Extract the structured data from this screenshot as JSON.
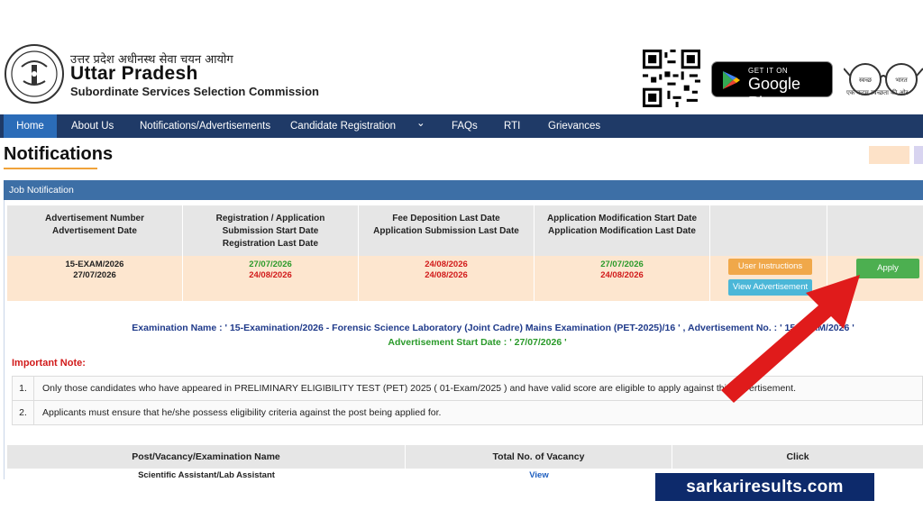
{
  "header": {
    "hindi_title": "उत्तर प्रदेश अधीनस्थ सेवा चयन आयोग",
    "title": "Uttar Pradesh",
    "subtitle": "Subordinate Services Selection Commission",
    "gplay_small": "GET IT ON",
    "gplay_big": "Google Play",
    "swachh_tagline": "एक कदम स्वच्छता की ओर"
  },
  "nav": {
    "items": [
      "Home",
      "About Us",
      "Notifications/Advertisements",
      "Candidate Registration",
      "⌄",
      "FAQs",
      "RTI",
      "Grievances"
    ]
  },
  "page": {
    "title": "Notifications"
  },
  "panel": {
    "title": "Job Notification"
  },
  "job_table": {
    "headers": [
      [
        "Advertisement Number",
        "Advertisement Date"
      ],
      [
        "Registration / Application",
        "Submission  Start Date",
        "Registration Last Date"
      ],
      [
        "Fee Deposition Last Date",
        "Application Submission Last Date"
      ],
      [
        "Application Modification Start Date",
        "Application Modification Last Date"
      ]
    ],
    "row": {
      "adv_number": "15-EXAM/2026",
      "adv_date": "27/07/2026",
      "reg_start": "27/07/2026",
      "reg_last": "24/08/2026",
      "fee_last": "24/08/2026",
      "app_sub_last": "24/08/2026",
      "mod_start": "27/07/2026",
      "mod_last": "24/08/2026"
    },
    "buttons": {
      "instructions": "User Instructions",
      "view_advertisement": "View Advertisement",
      "apply": "Apply"
    }
  },
  "exam_info": {
    "line": "Examination Name : ' 15-Examination/2026 - Forensic Science Laboratory (Joint Cadre) Mains Examination (PET-2025)/16 ' , Advertisement No. : ' 15-EXAM/2026 '",
    "advt_start": "Advertisement Start Date : ' 27/07/2026 '"
  },
  "notes": {
    "heading": "Important Note:",
    "items": [
      {
        "num": "1.",
        "text": "Only those candidates who have appeared in PRELIMINARY ELIGIBILITY TEST (PET) 2025 ( 01-Exam/2025 ) and have valid score are eligible to apply against this advertisement."
      },
      {
        "num": "2.",
        "text": "Applicants must ensure that he/she possess eligibility criteria against the post being applied for."
      }
    ]
  },
  "vacancy_table": {
    "headers": [
      "Post/Vacancy/Examination Name",
      "Total No.  of Vacancy",
      "Click"
    ],
    "row": {
      "post": "Scientific Assistant/Lab Assistant",
      "vacancy": "View"
    }
  },
  "watermark": {
    "text": "sarkariresults.com"
  },
  "colors": {
    "nav_bg": "#1f3a67",
    "nav_active": "#2b6cb8",
    "panel_head": "#3d6fa6",
    "apply_green": "#4caf50",
    "instructions_orange": "#f0a84a",
    "advertisement_blue": "#4bb7d8",
    "arrow_red": "#e01b1b",
    "watermark_bg": "#0d2a6b"
  }
}
